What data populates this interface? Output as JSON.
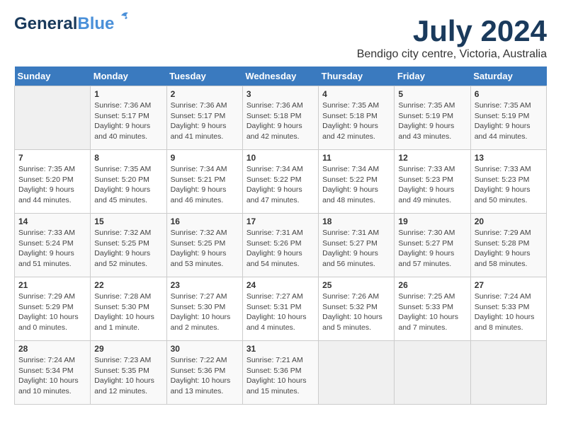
{
  "header": {
    "logo_general": "General",
    "logo_blue": "Blue",
    "month_year": "July 2024",
    "location": "Bendigo city centre, Victoria, Australia"
  },
  "columns": [
    "Sunday",
    "Monday",
    "Tuesday",
    "Wednesday",
    "Thursday",
    "Friday",
    "Saturday"
  ],
  "weeks": [
    [
      {
        "day": "",
        "empty": true
      },
      {
        "day": "1",
        "sunrise": "Sunrise: 7:36 AM",
        "sunset": "Sunset: 5:17 PM",
        "daylight": "Daylight: 9 hours and 40 minutes."
      },
      {
        "day": "2",
        "sunrise": "Sunrise: 7:36 AM",
        "sunset": "Sunset: 5:17 PM",
        "daylight": "Daylight: 9 hours and 41 minutes."
      },
      {
        "day": "3",
        "sunrise": "Sunrise: 7:36 AM",
        "sunset": "Sunset: 5:18 PM",
        "daylight": "Daylight: 9 hours and 42 minutes."
      },
      {
        "day": "4",
        "sunrise": "Sunrise: 7:35 AM",
        "sunset": "Sunset: 5:18 PM",
        "daylight": "Daylight: 9 hours and 42 minutes."
      },
      {
        "day": "5",
        "sunrise": "Sunrise: 7:35 AM",
        "sunset": "Sunset: 5:19 PM",
        "daylight": "Daylight: 9 hours and 43 minutes."
      },
      {
        "day": "6",
        "sunrise": "Sunrise: 7:35 AM",
        "sunset": "Sunset: 5:19 PM",
        "daylight": "Daylight: 9 hours and 44 minutes."
      }
    ],
    [
      {
        "day": "7",
        "sunrise": "Sunrise: 7:35 AM",
        "sunset": "Sunset: 5:20 PM",
        "daylight": "Daylight: 9 hours and 44 minutes."
      },
      {
        "day": "8",
        "sunrise": "Sunrise: 7:35 AM",
        "sunset": "Sunset: 5:20 PM",
        "daylight": "Daylight: 9 hours and 45 minutes."
      },
      {
        "day": "9",
        "sunrise": "Sunrise: 7:34 AM",
        "sunset": "Sunset: 5:21 PM",
        "daylight": "Daylight: 9 hours and 46 minutes."
      },
      {
        "day": "10",
        "sunrise": "Sunrise: 7:34 AM",
        "sunset": "Sunset: 5:22 PM",
        "daylight": "Daylight: 9 hours and 47 minutes."
      },
      {
        "day": "11",
        "sunrise": "Sunrise: 7:34 AM",
        "sunset": "Sunset: 5:22 PM",
        "daylight": "Daylight: 9 hours and 48 minutes."
      },
      {
        "day": "12",
        "sunrise": "Sunrise: 7:33 AM",
        "sunset": "Sunset: 5:23 PM",
        "daylight": "Daylight: 9 hours and 49 minutes."
      },
      {
        "day": "13",
        "sunrise": "Sunrise: 7:33 AM",
        "sunset": "Sunset: 5:23 PM",
        "daylight": "Daylight: 9 hours and 50 minutes."
      }
    ],
    [
      {
        "day": "14",
        "sunrise": "Sunrise: 7:33 AM",
        "sunset": "Sunset: 5:24 PM",
        "daylight": "Daylight: 9 hours and 51 minutes."
      },
      {
        "day": "15",
        "sunrise": "Sunrise: 7:32 AM",
        "sunset": "Sunset: 5:25 PM",
        "daylight": "Daylight: 9 hours and 52 minutes."
      },
      {
        "day": "16",
        "sunrise": "Sunrise: 7:32 AM",
        "sunset": "Sunset: 5:25 PM",
        "daylight": "Daylight: 9 hours and 53 minutes."
      },
      {
        "day": "17",
        "sunrise": "Sunrise: 7:31 AM",
        "sunset": "Sunset: 5:26 PM",
        "daylight": "Daylight: 9 hours and 54 minutes."
      },
      {
        "day": "18",
        "sunrise": "Sunrise: 7:31 AM",
        "sunset": "Sunset: 5:27 PM",
        "daylight": "Daylight: 9 hours and 56 minutes."
      },
      {
        "day": "19",
        "sunrise": "Sunrise: 7:30 AM",
        "sunset": "Sunset: 5:27 PM",
        "daylight": "Daylight: 9 hours and 57 minutes."
      },
      {
        "day": "20",
        "sunrise": "Sunrise: 7:29 AM",
        "sunset": "Sunset: 5:28 PM",
        "daylight": "Daylight: 9 hours and 58 minutes."
      }
    ],
    [
      {
        "day": "21",
        "sunrise": "Sunrise: 7:29 AM",
        "sunset": "Sunset: 5:29 PM",
        "daylight": "Daylight: 10 hours and 0 minutes."
      },
      {
        "day": "22",
        "sunrise": "Sunrise: 7:28 AM",
        "sunset": "Sunset: 5:30 PM",
        "daylight": "Daylight: 10 hours and 1 minute."
      },
      {
        "day": "23",
        "sunrise": "Sunrise: 7:27 AM",
        "sunset": "Sunset: 5:30 PM",
        "daylight": "Daylight: 10 hours and 2 minutes."
      },
      {
        "day": "24",
        "sunrise": "Sunrise: 7:27 AM",
        "sunset": "Sunset: 5:31 PM",
        "daylight": "Daylight: 10 hours and 4 minutes."
      },
      {
        "day": "25",
        "sunrise": "Sunrise: 7:26 AM",
        "sunset": "Sunset: 5:32 PM",
        "daylight": "Daylight: 10 hours and 5 minutes."
      },
      {
        "day": "26",
        "sunrise": "Sunrise: 7:25 AM",
        "sunset": "Sunset: 5:33 PM",
        "daylight": "Daylight: 10 hours and 7 minutes."
      },
      {
        "day": "27",
        "sunrise": "Sunrise: 7:24 AM",
        "sunset": "Sunset: 5:33 PM",
        "daylight": "Daylight: 10 hours and 8 minutes."
      }
    ],
    [
      {
        "day": "28",
        "sunrise": "Sunrise: 7:24 AM",
        "sunset": "Sunset: 5:34 PM",
        "daylight": "Daylight: 10 hours and 10 minutes."
      },
      {
        "day": "29",
        "sunrise": "Sunrise: 7:23 AM",
        "sunset": "Sunset: 5:35 PM",
        "daylight": "Daylight: 10 hours and 12 minutes."
      },
      {
        "day": "30",
        "sunrise": "Sunrise: 7:22 AM",
        "sunset": "Sunset: 5:36 PM",
        "daylight": "Daylight: 10 hours and 13 minutes."
      },
      {
        "day": "31",
        "sunrise": "Sunrise: 7:21 AM",
        "sunset": "Sunset: 5:36 PM",
        "daylight": "Daylight: 10 hours and 15 minutes."
      },
      {
        "day": "",
        "empty": true
      },
      {
        "day": "",
        "empty": true
      },
      {
        "day": "",
        "empty": true
      }
    ]
  ]
}
